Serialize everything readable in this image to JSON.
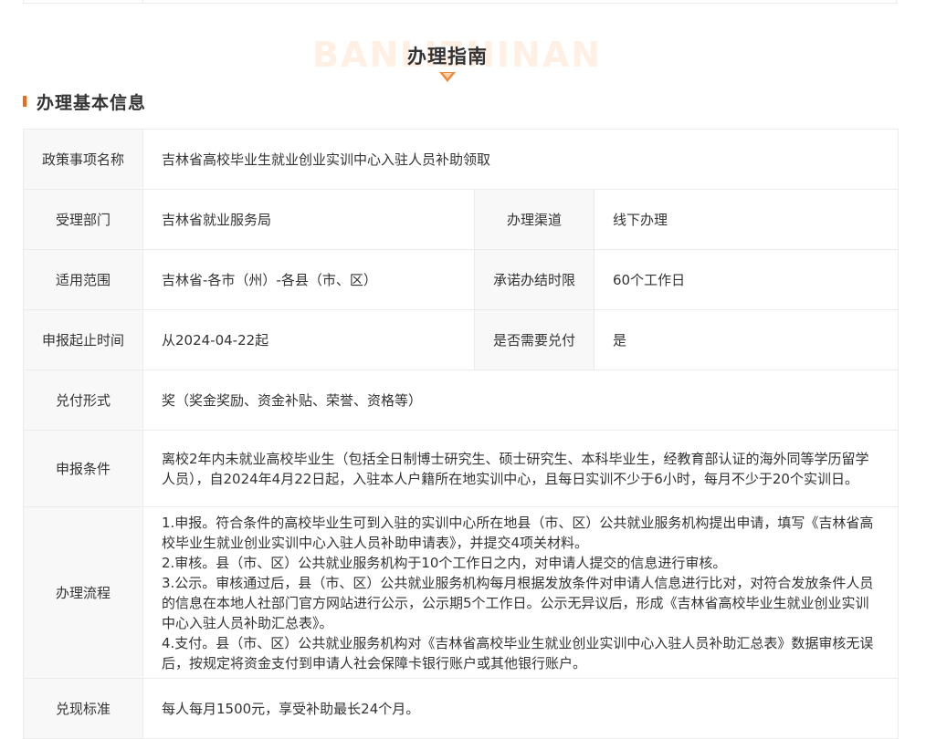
{
  "section": {
    "watermark": "BANLIZHINAN",
    "title": "办理指南",
    "subtitle": "办理基本信息"
  },
  "info": {
    "policy_name_label": "政策事项名称",
    "policy_name": "吉林省高校毕业生就业创业实训中心入驻人员补助领取",
    "department_label": "受理部门",
    "department": "吉林省就业服务局",
    "channel_label": "办理渠道",
    "channel": "线下办理",
    "scope_label": "适用范围",
    "scope": "吉林省-各市（州）-各县（市、区）",
    "deadline_label": "承诺办结时限",
    "deadline": "60个工作日",
    "apply_time_label": "申报起止时间",
    "apply_time": "从2024-04-22起",
    "need_payment_label": "是否需要兑付",
    "need_payment": "是",
    "payment_form_label": "兑付形式",
    "payment_form": "奖（奖金奖励、资金补贴、荣誉、资格等）",
    "conditions_label": "申报条件",
    "conditions": "离校2年内未就业高校毕业生（包括全日制博士研究生、硕士研究生、本科毕业生，经教育部认证的海外同等学历留学人员），自2024年4月22日起，入驻本人户籍所在地实训中心，且每日实训不少于6小时，每月不少于20个实训日。",
    "process_label": "办理流程",
    "process_steps": [
      "1.申报。符合条件的高校毕业生可到入驻的实训中心所在地县（市、区）公共就业服务机构提出申请，填写《吉林省高校毕业生就业创业实训中心入驻人员补助申请表》，并提交4项关材料。",
      "2.审核。县（市、区）公共就业服务机构于10个工作日之内，对申请人提交的信息进行审核。",
      "3.公示。审核通过后，县（市、区）公共就业服务机构每月根据发放条件对申请人信息进行比对，对符合发放条件人员的信息在本地人社部门官方网站进行公示，公示期5个工作日。公示无异议后，形成《吉林省高校毕业生就业创业实训中心入驻人员补助汇总表》。",
      "4.支付。县（市、区）公共就业服务机构对《吉林省高校毕业生就业创业实训中心入驻人员补助汇总表》数据审核无误后，按规定将资金支付到申请人社会保障卡银行账户或其他银行账户。"
    ],
    "standard_label": "兑现标准",
    "standard": "每人每月1500元，享受补助最长24个月。"
  },
  "colors": {
    "accent": "#ef6a16",
    "label_bg": "#f8f8f8",
    "border": "#ececec"
  },
  "icons": {
    "heading_marker": "down-triangle-icon"
  }
}
